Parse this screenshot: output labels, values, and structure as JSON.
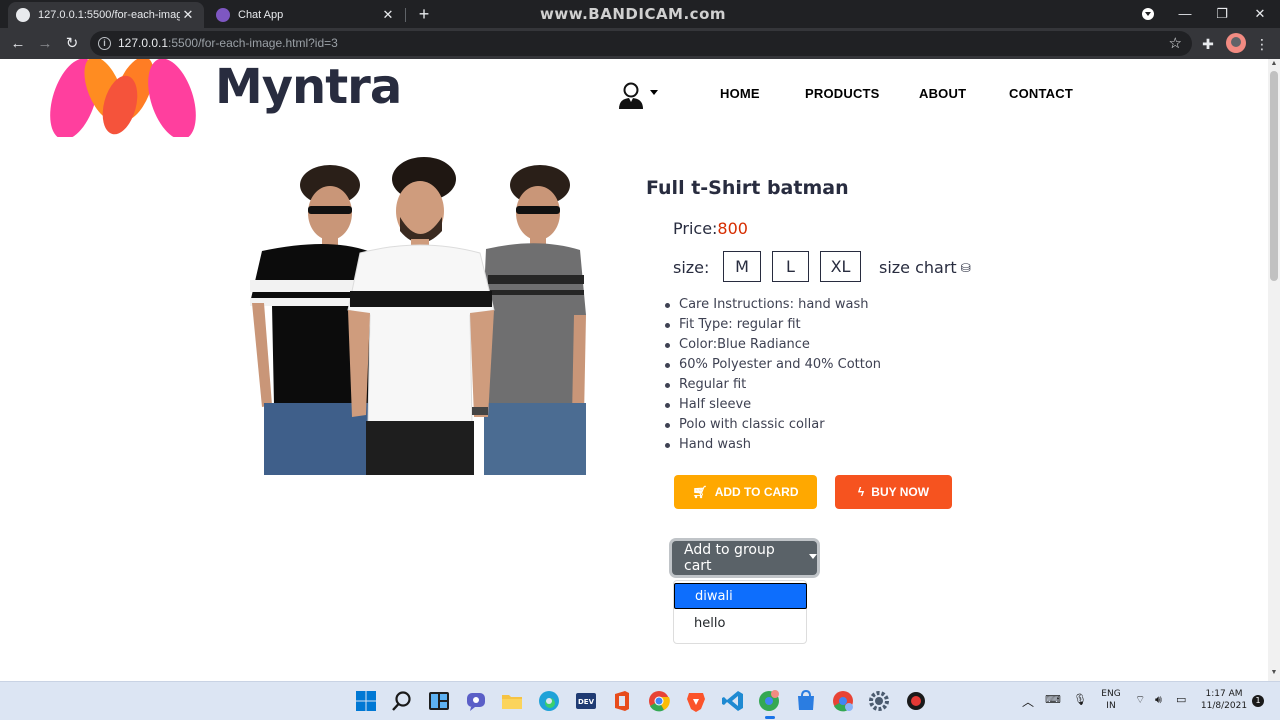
{
  "browser": {
    "tabs": [
      {
        "title": "127.0.0.1:5500/for-each-image.ht",
        "active": true
      },
      {
        "title": "Chat App",
        "active": false
      }
    ],
    "watermark": "www.BANDICAM.com",
    "url_host": "127.0.0.1",
    "url_rest": ":5500/for-each-image.html?id=3",
    "icons": {
      "back": "back-arrow-icon",
      "forward": "forward-arrow-icon",
      "reload": "reload-icon",
      "bookmark": "star-icon",
      "extensions": "puzzle-icon"
    }
  },
  "site": {
    "brand": "Myntra",
    "nav": [
      "HOME",
      "PRODUCTS",
      "ABOUT",
      "CONTACT"
    ]
  },
  "product": {
    "title": "Full t-Shirt batman",
    "price_label": "Price:",
    "price_value": "800",
    "size_label": "size:",
    "sizes": [
      "M",
      "L",
      "XL"
    ],
    "size_chart_label": "size chart",
    "features": [
      "Care Instructions: hand wash",
      "Fit Type: regular fit",
      "Color:Blue Radiance",
      "60% Polyester and 40% Cotton",
      "Regular fit",
      "Half sleeve",
      "Polo with classic collar",
      "Hand wash"
    ],
    "add_to_cart_label": "ADD TO CARD",
    "buy_now_label": "BUY NOW",
    "group_cart_label": "Add to group cart",
    "group_options": [
      "diwali",
      "hello"
    ],
    "selected_group": "diwali"
  },
  "colors": {
    "brand_text": "#282c3f",
    "price": "#d62d00",
    "add_to_cart": "#ffa800",
    "buy_now": "#f6531f",
    "group_button": "#5a6268",
    "selected_option": "#0d6efd"
  },
  "taskbar": {
    "lang_top": "ENG",
    "lang_bottom": "IN",
    "time": "1:17 AM",
    "date": "11/8/2021",
    "notifications": "1"
  }
}
